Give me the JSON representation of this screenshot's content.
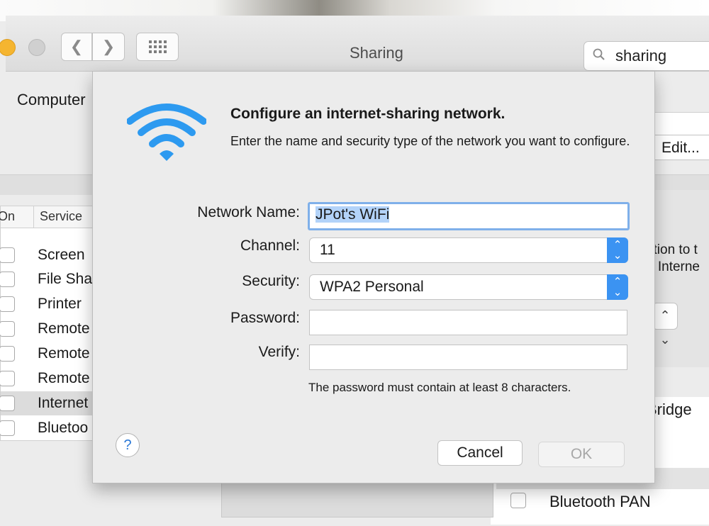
{
  "window": {
    "title": "Sharing",
    "search_value": "sharing",
    "computer_label": "Computer",
    "edit_button": "Edit...",
    "right_text_1": "ction to t",
    "right_text_2": "e Interne",
    "bridge_label": "Bridge",
    "bluetooth_pan_label": "Bluetooth PAN"
  },
  "services": {
    "col_on": "On",
    "col_service": "Service",
    "items": [
      {
        "label": "Screen"
      },
      {
        "label": "File Sha"
      },
      {
        "label": "Printer"
      },
      {
        "label": "Remote"
      },
      {
        "label": "Remote"
      },
      {
        "label": "Remote"
      },
      {
        "label": "Internet"
      },
      {
        "label": "Bluetoo"
      }
    ]
  },
  "dialog": {
    "title": "Configure an internet-sharing network.",
    "message": "Enter the name and security type of the network you want to configure.",
    "network_name_label": "Network Name:",
    "network_name_value": "JPot's WiFi",
    "channel_label": "Channel:",
    "channel_value": "11",
    "security_label": "Security:",
    "security_value": "WPA2 Personal",
    "password_label": "Password:",
    "verify_label": "Verify:",
    "hint": "The password must contain at least 8 characters.",
    "help_label": "?",
    "cancel_button": "Cancel",
    "ok_button": "OK"
  },
  "colors": {
    "accent": "#3b93f2",
    "wifi": "#2d9af0",
    "focus_ring": "#7fb0ea"
  },
  "icons": [
    "search-icon",
    "chevron-left-icon",
    "chevron-right-icon",
    "grid-icon",
    "wifi-icon",
    "help-icon",
    "stepper-icon"
  ]
}
